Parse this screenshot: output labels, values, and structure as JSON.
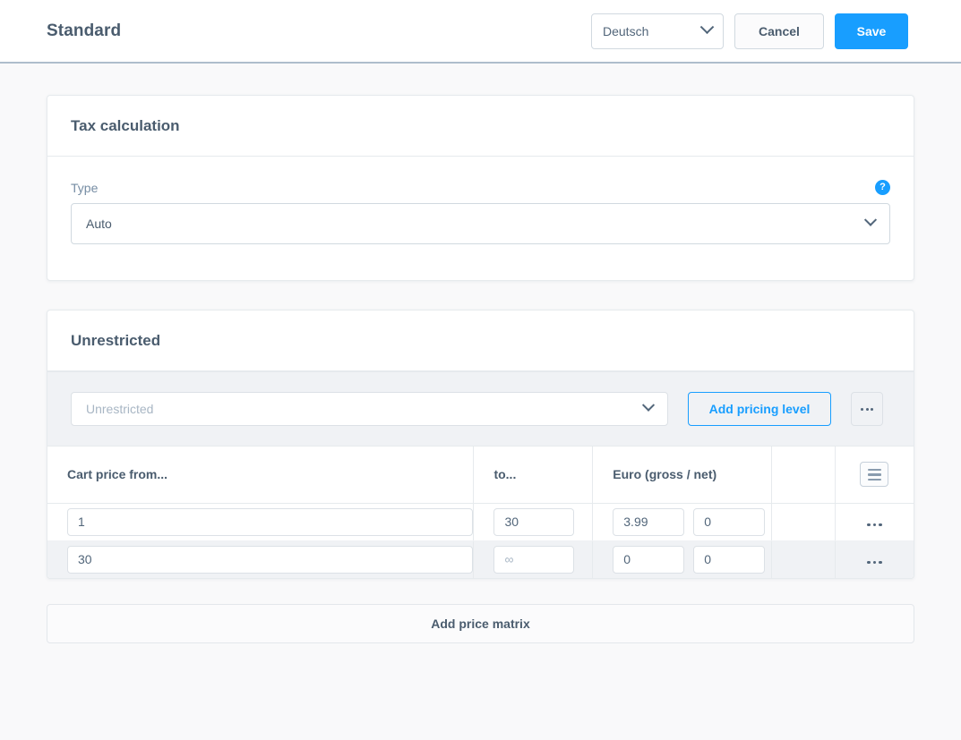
{
  "header": {
    "title": "Standard",
    "language_value": "Deutsch",
    "cancel_label": "Cancel",
    "save_label": "Save",
    "chevron_icon": "chevron-down-icon"
  },
  "tax_card": {
    "title": "Tax calculation",
    "type_label": "Type",
    "type_value": "Auto",
    "help_icon": "?",
    "chevron_icon": "chevron-down-icon"
  },
  "price_card": {
    "title": "Unrestricted",
    "rule_placeholder": "Unrestricted",
    "add_pricing_level_label": "Add pricing level",
    "context_menu_icon": "ellipsis-icon",
    "chevron_icon": "chevron-down-icon",
    "columns": [
      "Cart price from...",
      "to...",
      "Euro (gross / net)",
      "",
      ""
    ],
    "header_menu_icon": "hamburger-icon",
    "rows": [
      {
        "from": "1",
        "to": "30",
        "to_placeholder": "",
        "gross": "3.99",
        "net": "0",
        "row_menu_icon": "ellipsis-icon"
      },
      {
        "from": "30",
        "to": "",
        "to_placeholder": "∞",
        "gross": "0",
        "net": "0",
        "row_menu_icon": "ellipsis-icon"
      }
    ]
  },
  "add_matrix": {
    "label": "Add price matrix"
  },
  "colors": {
    "accent": "#189eff",
    "text": "#4a5c6e",
    "muted": "#758ca3",
    "page_bg": "#f9f9fa",
    "toolbar_bg": "#f0f2f5",
    "border": "#e6eaed"
  }
}
